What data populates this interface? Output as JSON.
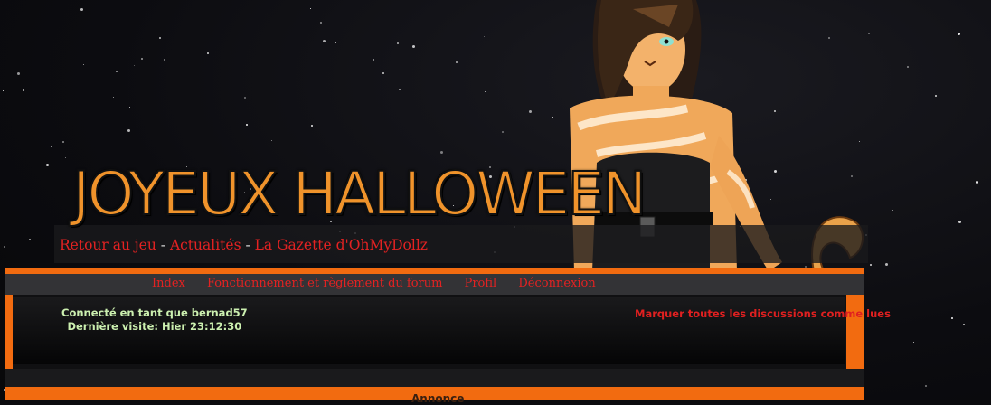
{
  "banner": {
    "title": "JOYEUX HALLOWEEN",
    "links": [
      {
        "label": "Retour au jeu"
      },
      {
        "label": "Actualités"
      },
      {
        "label": "La Gazette d'OhMyDollz"
      }
    ],
    "separator": " - "
  },
  "nav": {
    "items": [
      {
        "label": "Index"
      },
      {
        "label": "Fonctionnement et règlement du forum"
      },
      {
        "label": "Profil"
      },
      {
        "label": "Déconnexion"
      }
    ]
  },
  "user_panel": {
    "connected_as": "Connecté en tant que bernad57",
    "last_visit": "Dernière visite: Hier 23:12:30",
    "mark_all_read": "Marquer toutes les discussions comme lues"
  },
  "announcement": {
    "title": "Annonce"
  },
  "colors": {
    "accent_orange": "#f26b10",
    "link_red": "#e32222",
    "panel_dark": "#101012",
    "nav_grey": "#333336",
    "user_text_green": "#ccf0b0"
  }
}
